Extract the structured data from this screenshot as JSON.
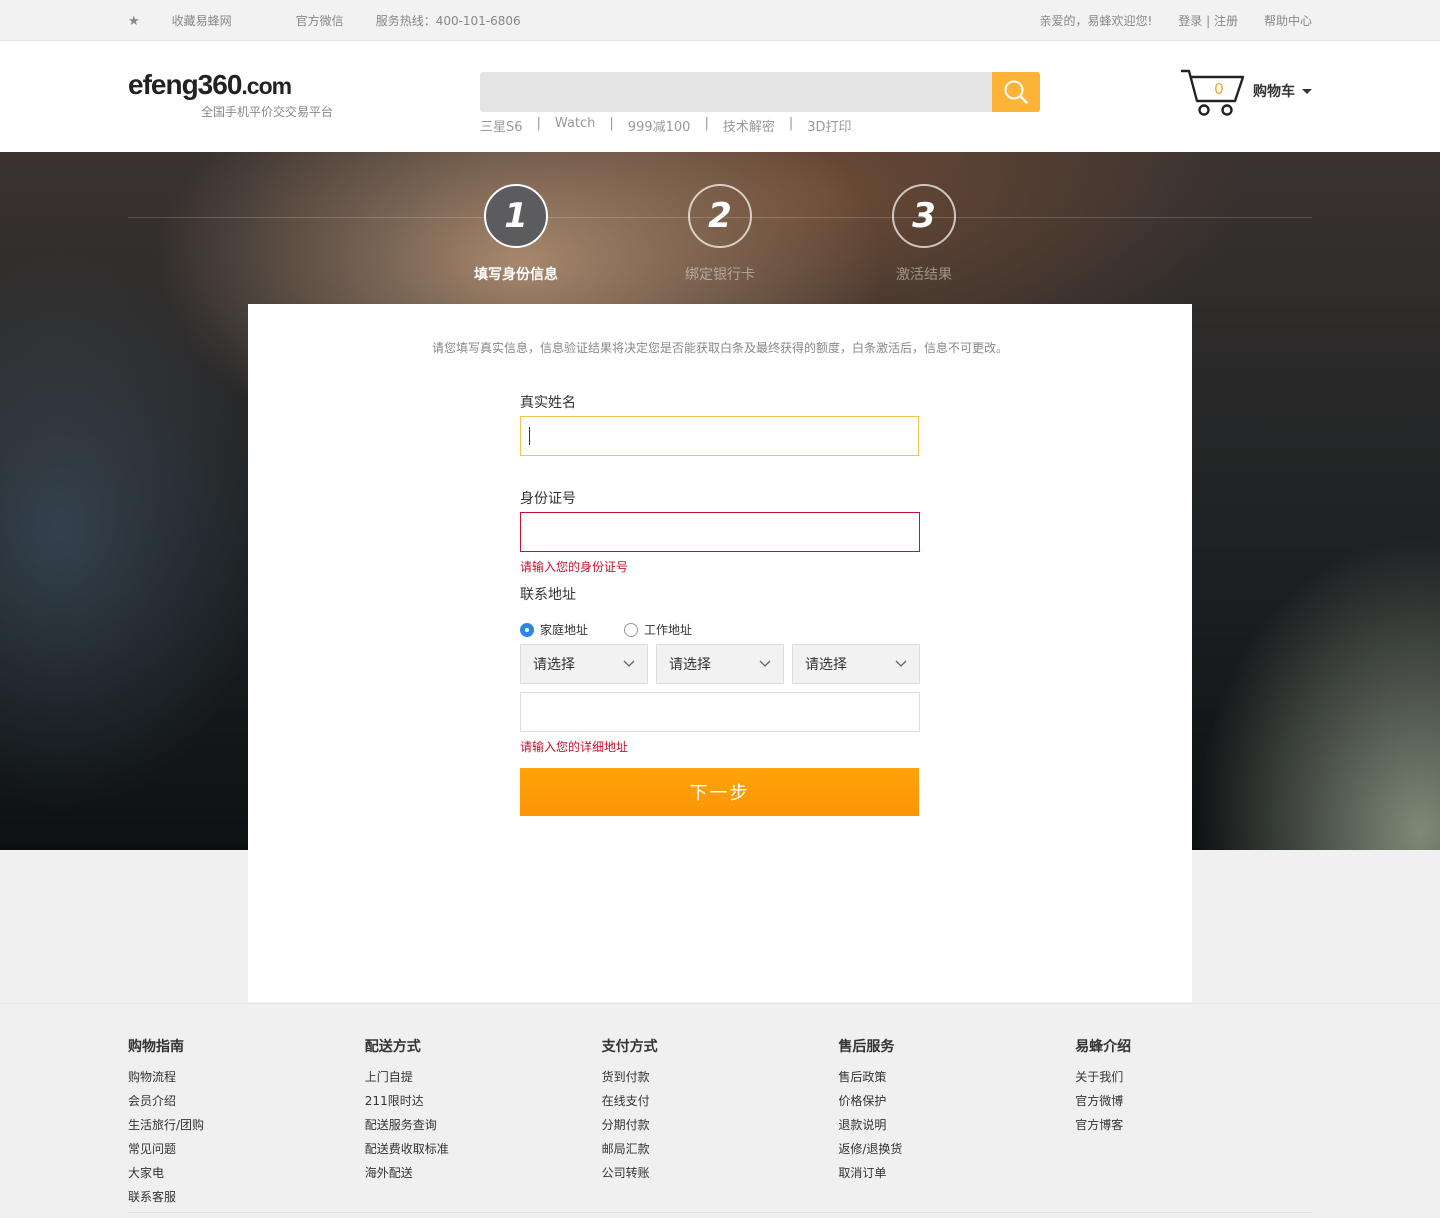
{
  "topbar": {
    "favorite": "收藏易蜂网",
    "wechat": "官方微信",
    "hotline": "服务热线：400-101-6806",
    "welcome": "亲爱的，易蜂欢迎您!",
    "login": "登录",
    "divider": "|",
    "register": "注册",
    "help": "帮助中心"
  },
  "header": {
    "logo_main": "efeng360",
    "logo_tld": ".com",
    "logo_sub": "全国手机平价交交易平台",
    "search_placeholder": "",
    "hotwords": [
      "三星S6",
      "Watch",
      "999减100",
      "技术解密",
      "3D打印"
    ],
    "hotword_sep": "|",
    "cart_count": "0",
    "cart_label": "购物车"
  },
  "steps": [
    {
      "num": "1",
      "label": "填写身份信息",
      "active": true
    },
    {
      "num": "2",
      "label": "绑定银行卡",
      "active": false
    },
    {
      "num": "3",
      "label": "激活结果",
      "active": false
    }
  ],
  "form": {
    "notice": "请您填写真实信息，信息验证结果将决定您是否能获取白条及最终获得的额度，白条激活后，信息不可更改。",
    "name_label": "真实姓名",
    "id_label": "身份证号",
    "id_error": "请输入您的身份证号",
    "address_label": "联系地址",
    "radio_home": "家庭地址",
    "radio_work": "工作地址",
    "selected_address_type": "家庭地址",
    "select_1": "请选择",
    "select_2": "请选择",
    "select_3": "请选择",
    "address_error": "请输入您的详细地址",
    "next_button": "下一步"
  },
  "footer": {
    "columns": [
      {
        "title": "购物指南",
        "links": [
          "购物流程",
          "会员介绍",
          "生活旅行/团购",
          "常见问题",
          "大家电",
          "联系客服"
        ]
      },
      {
        "title": "配送方式",
        "links": [
          "上门自提",
          "211限时达",
          "配送服务查询",
          "配送费收取标准",
          "海外配送"
        ]
      },
      {
        "title": "支付方式",
        "links": [
          "货到付款",
          "在线支付",
          "分期付款",
          "邮局汇款",
          "公司转账"
        ]
      },
      {
        "title": "售后服务",
        "links": [
          "售后政策",
          "价格保护",
          "退款说明",
          "返修/退换货",
          "取消订单"
        ]
      },
      {
        "title": "易蜂介绍",
        "links": [
          "关于我们",
          "官方微博",
          "官方博客"
        ]
      }
    ]
  },
  "colors": {
    "accent_orange": "#fea40a",
    "search_button": "#fdb338",
    "error_red": "#c8102e",
    "radio_blue": "#2b87e8"
  },
  "icons": [
    "star-icon",
    "search-icon",
    "cart-icon",
    "caret-down-icon",
    "chevron-down-icon"
  ]
}
